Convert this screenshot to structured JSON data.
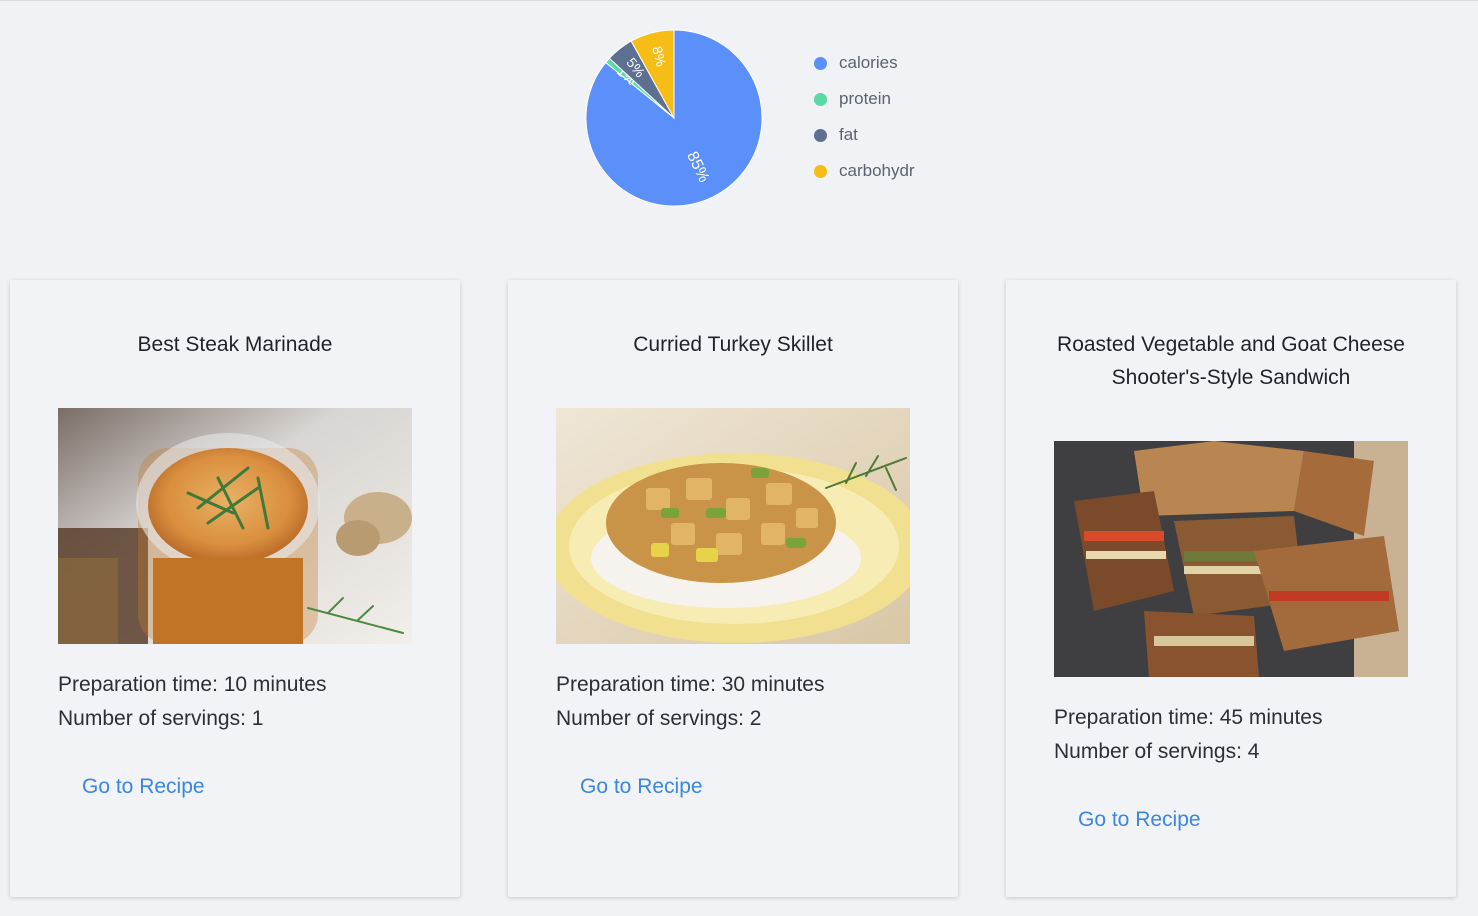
{
  "chart_data": {
    "type": "pie",
    "labels": [
      "calories",
      "protein",
      "fat",
      "carbohydr"
    ],
    "values": [
      85,
      1,
      5,
      8
    ],
    "slice_labels": [
      "85%",
      "1%",
      "5%",
      "8%"
    ],
    "colors": [
      "#5b8ff9",
      "#5ad8a6",
      "#5d7092",
      "#f6bd16"
    ],
    "legend_position": "right"
  },
  "legend": {
    "items": [
      {
        "label": "calories",
        "color": "#5b8ff9"
      },
      {
        "label": "protein",
        "color": "#5ad8a6"
      },
      {
        "label": "fat",
        "color": "#5d7092"
      },
      {
        "label": "carbohydr",
        "color": "#f6bd16"
      }
    ]
  },
  "cards": [
    {
      "title": "Best Steak Marinade",
      "prep": "Preparation time: 10 minutes",
      "servings": "Number of servings: 1",
      "link": "Go to Recipe"
    },
    {
      "title": "Curried Turkey Skillet",
      "prep": "Preparation time: 30 minutes",
      "servings": "Number of servings: 2",
      "link": "Go to Recipe"
    },
    {
      "title": "Roasted Vegetable and Goat Cheese Shooter's-Style Sandwich",
      "prep": "Preparation time: 45 minutes",
      "servings": "Number of servings: 4",
      "link": "Go to Recipe"
    }
  ]
}
